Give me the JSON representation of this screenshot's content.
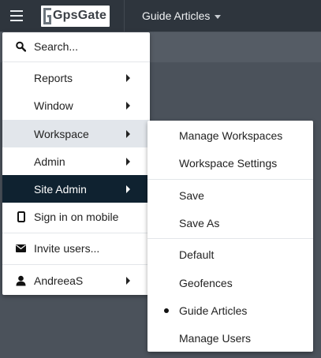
{
  "topbar": {
    "logo_text": "GpsGate",
    "workspace_title": "Guide Articles"
  },
  "menu": {
    "search": "Search...",
    "reports": "Reports",
    "window": "Window",
    "workspace": "Workspace",
    "admin": "Admin",
    "site_admin": "Site Admin",
    "sign_in_mobile": "Sign in on mobile",
    "invite_users": "Invite users...",
    "user": "AndreeaS"
  },
  "submenu": {
    "manage_workspaces": "Manage Workspaces",
    "workspace_settings": "Workspace Settings",
    "save": "Save",
    "save_as": "Save As",
    "default": "Default",
    "geofences": "Geofences",
    "guide_articles": "Guide Articles",
    "manage_users": "Manage Users",
    "selected": "Guide Articles"
  },
  "colors": {
    "topbar": "#2e353d",
    "background": "#4b525b",
    "active_item": "#0f2230",
    "hover_item": "#e2e6eb"
  }
}
